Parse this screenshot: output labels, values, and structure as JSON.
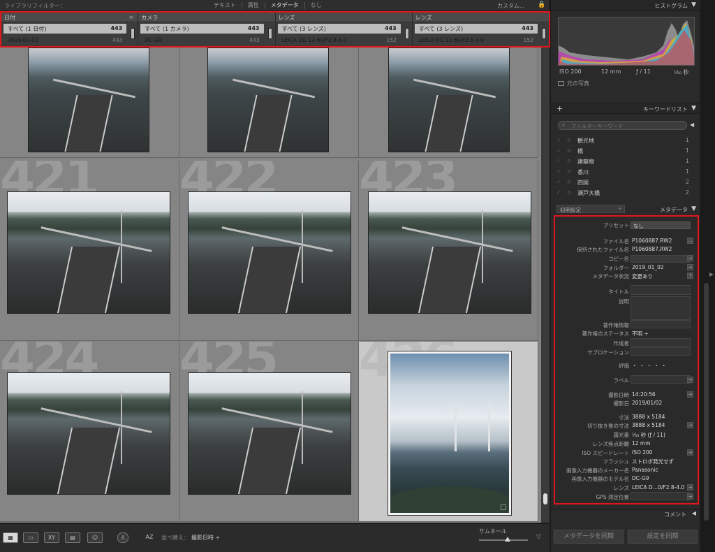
{
  "filterbar": {
    "label": "ライブラリフィルター：",
    "modes": [
      "テキスト",
      "属性",
      "メタデータ",
      "なし"
    ],
    "active_mode": "メタデータ",
    "custom": "カスタム…"
  },
  "columns": [
    {
      "header": "日付",
      "all": "すべて (1 日付)",
      "all_count": "443",
      "item": "2019-01-02",
      "item_count": "443"
    },
    {
      "header": "カメラ",
      "all": "すべて (1 カメラ)",
      "all_count": "443",
      "item": "DC-G9",
      "item_count": "443"
    },
    {
      "header": "レンズ",
      "all": "すべて (3 レンズ)",
      "all_count": "443",
      "item": "LEICA DG 12-60/F2.8-4.0",
      "item_count": "152"
    },
    {
      "header": "レンズ",
      "all": "すべて (3 レンズ)",
      "all_count": "443",
      "item": "LEICA DG 12-60/F2.8-4.0",
      "item_count": "152"
    }
  ],
  "grid": {
    "cells": [
      {
        "num": "",
        "orientation": "top"
      },
      {
        "num": "",
        "orientation": "top"
      },
      {
        "num": "",
        "orientation": "top"
      },
      {
        "num": "421",
        "orientation": "wide"
      },
      {
        "num": "422",
        "orientation": "wide"
      },
      {
        "num": "423",
        "orientation": "wide"
      },
      {
        "num": "424",
        "orientation": "wide"
      },
      {
        "num": "425",
        "orientation": "wide"
      },
      {
        "num": "426",
        "orientation": "portrait",
        "selected": true
      }
    ]
  },
  "toolbar": {
    "sort_label": "並べ替え：",
    "sort_value": "撮影日時 ÷",
    "thumbnail_label": "サムネール",
    "thumbnail_level": 0.58
  },
  "right_panel": {
    "histogram_title": "ヒストグラム",
    "iso": "ISO 200",
    "focal": "12 mm",
    "fstop": "ƒ / 11",
    "shutter": "¹⁄₅₀ 秒",
    "original_photo": "元の写真",
    "keyword_title": "キーワードリスト",
    "keyword_filter_placeholder": "フィルターキーワード",
    "keywords": [
      {
        "name": "観光地",
        "count": "1"
      },
      {
        "name": "橋",
        "count": "1"
      },
      {
        "name": "建築物",
        "count": "1"
      },
      {
        "name": "香川",
        "count": "1"
      },
      {
        "name": "四国",
        "count": "2"
      },
      {
        "name": "瀬戸大橋",
        "count": "2"
      }
    ],
    "metadata_preset_select": "初期設定",
    "metadata_title": "メタデータ",
    "preset_label": "プリセット",
    "preset_value": "なし",
    "fields": {
      "filename_k": "ファイル名",
      "filename_v": "P1060887.RW2",
      "saved_filename_k": "保持されたファイル名",
      "saved_filename_v": "P1060887.RW2",
      "copy_name_k": "コピー名",
      "folder_k": "フォルダー",
      "folder_v": "2019_01_02",
      "meta_status_k": "メタデータ状況",
      "meta_status_v": "変更あり",
      "title_k": "タイトル",
      "caption_k": "説明",
      "copyright_k": "著作権情報",
      "copyright_status_k": "著作権のステータス",
      "copyright_status_v": "不明 ÷",
      "creator_k": "作成者",
      "sublocation_k": "サブロケーション",
      "rating_k": "評価",
      "rating_v": "・・・・・",
      "label_k": "ラベル",
      "capture_time_k": "撮影日時",
      "capture_time_v": "14:20:56",
      "capture_date_k": "撮影日",
      "capture_date_v": "2019/01/02",
      "dimensions_k": "寸法",
      "dimensions_v": "3888 x 5184",
      "cropped_k": "切り抜き後の寸法",
      "cropped_v": "3888 x 5184",
      "exposure_k": "露光量",
      "exposure_v": "¹⁄₅₀ 秒 (ƒ / 11)",
      "focal_k": "レンズ焦点距離",
      "focal_v": "12 mm",
      "iso_k": "ISO スピードレート",
      "iso_v": "ISO 200",
      "flash_k": "フラッシュ",
      "flash_v": "ストロボ発光せず",
      "make_k": "画像入力機器のメーカー名",
      "make_v": "Panasonic",
      "model_k": "画像入力機器のモデル名",
      "model_v": "DC-G9",
      "lens_k": "レンズ",
      "lens_v": "LEICA D…0/F2.8-4.0",
      "gps_k": "GPS 測定位置"
    },
    "comment_title": "コメント",
    "sync_meta_button": "メタデータを同期",
    "sync_settings_button": "設定を同期"
  }
}
